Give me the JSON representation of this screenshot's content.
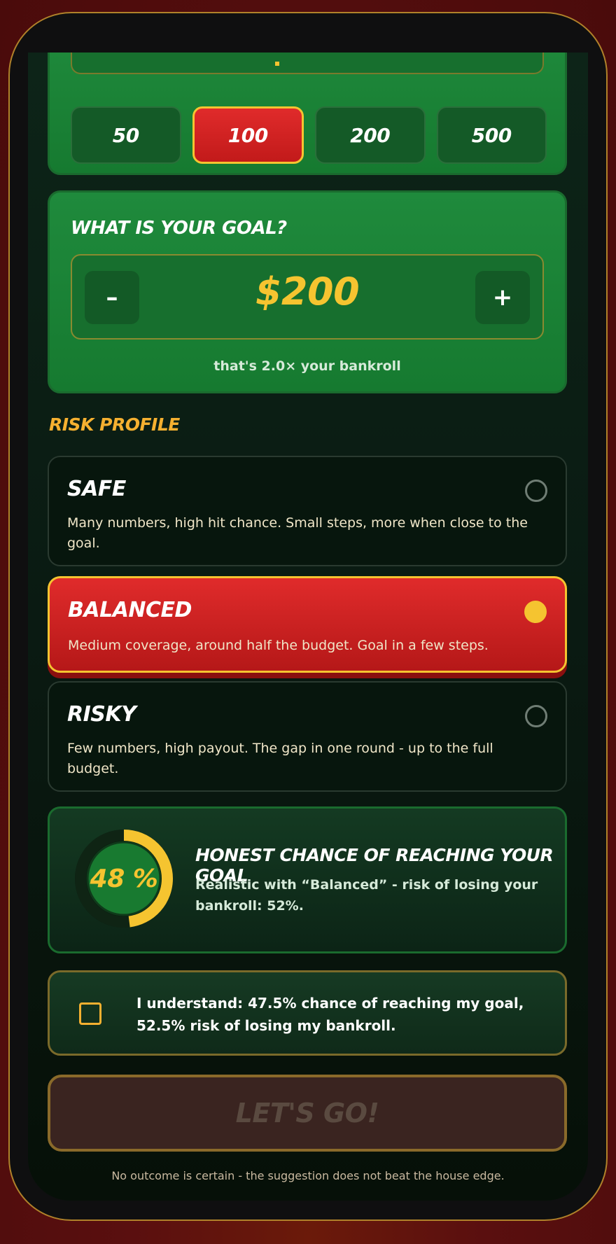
{
  "bankroll": {
    "chips": [
      "50",
      "100",
      "200",
      "500"
    ],
    "active_chip": "100"
  },
  "goal": {
    "title": "WHAT IS YOUR GOAL?",
    "minus_label": "–",
    "plus_label": "+",
    "value": "$200",
    "ratio_text": "that's 2.0× your bankroll"
  },
  "risk": {
    "heading": "RISK PROFILE",
    "options": [
      {
        "title": "SAFE",
        "desc": "Many numbers, high hit chance. Small steps, more when close to the goal.",
        "selected": false
      },
      {
        "title": "BALANCED",
        "desc": "Medium coverage, around half the budget. Goal in a few steps.",
        "selected": true
      },
      {
        "title": "RISKY",
        "desc": "Few numbers, high payout. The gap in one round - up to the full budget.",
        "selected": false
      }
    ]
  },
  "chance": {
    "percent_label": "48 %",
    "percent_value": 48,
    "title": "HONEST CHANCE OF REACHING YOUR GOAL",
    "desc": "Realistic with “Balanced” - risk of losing your bankroll: 52%."
  },
  "acknowledge": {
    "text": "I understand: 47.5% chance of reaching my goal, 52.5% risk of losing my bankroll.",
    "checked": false
  },
  "cta": {
    "label": "LET'S GO!"
  },
  "disclaimer": "No outcome is certain - the suggestion does not beat the house edge.",
  "colors": {
    "accent_gold": "#f5c430",
    "active_red": "#e02b2b",
    "card_green": "#1f8a3c"
  }
}
